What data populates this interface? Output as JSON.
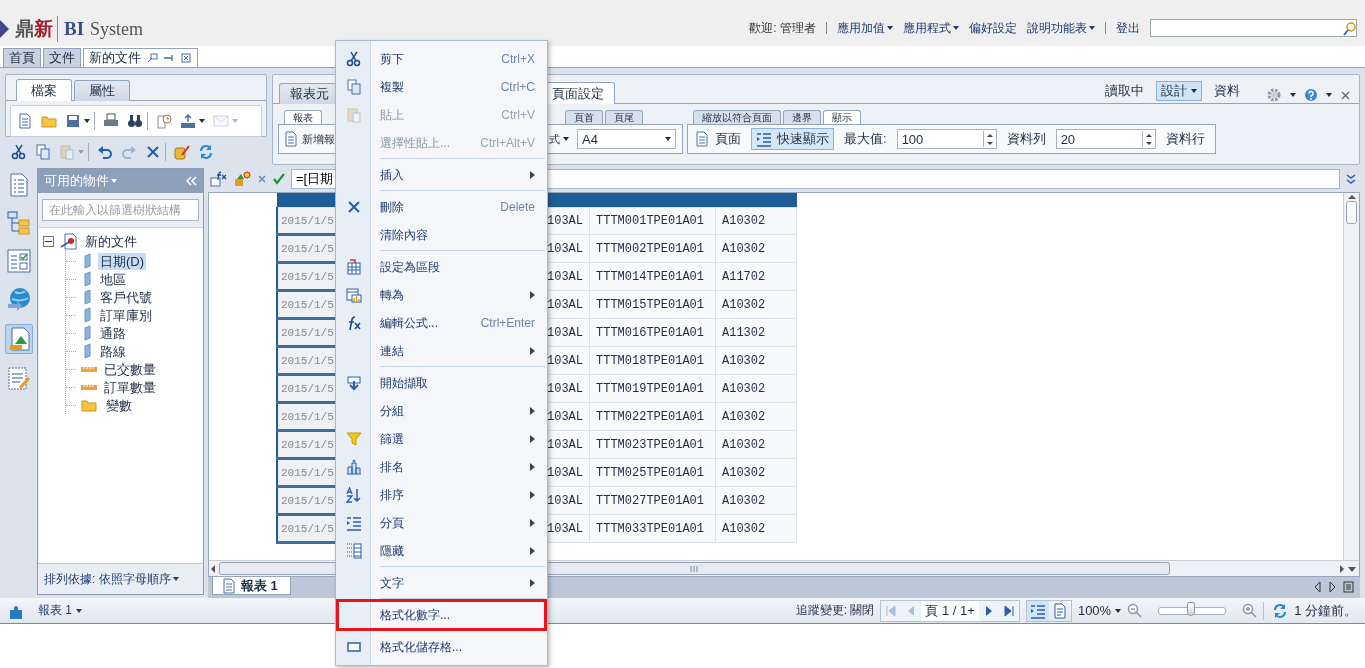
{
  "header": {
    "logo": {
      "first": "鼎",
      "second": "新",
      "product": "BI",
      "suffix": "System"
    },
    "welcome": "歡迎: 管理者",
    "menus": [
      {
        "label": "應用加值",
        "dropdown": true
      },
      {
        "label": "應用程式",
        "dropdown": true
      },
      {
        "label": "偏好設定",
        "dropdown": false
      },
      {
        "label": "說明功能表",
        "dropdown": true
      }
    ],
    "logout": "登出"
  },
  "doc_tabs": [
    {
      "label": "首頁",
      "selected": false
    },
    {
      "label": "文件",
      "selected": false
    },
    {
      "label": "新的文件",
      "selected": true
    }
  ],
  "left_ribbon": {
    "tabs": [
      {
        "label": "檔案",
        "selected": true
      },
      {
        "label": "屬性",
        "selected": false
      }
    ],
    "toolbar_rows": [
      [
        {
          "tools": [
            {
              "disabled": false,
              "dropdown": false
            },
            {
              "disabled": false,
              "dropdown": false
            },
            {
              "disabled": false,
              "dropdown": true
            }
          ]
        },
        {
          "tools": [
            {
              "disabled": false,
              "dropdown": false
            },
            {
              "disabled": false,
              "dropdown": false
            }
          ]
        },
        {
          "tools": [
            {
              "disabled": false,
              "dropdown": false
            },
            {
              "disabled": false,
              "dropdown": true
            },
            {
              "disabled": true,
              "dropdown": true
            }
          ]
        }
      ],
      [
        {
          "tools": [
            {
              "disabled": false,
              "dropdown": false
            },
            {
              "disabled": false,
              "dropdown": false
            },
            {
              "disabled": true,
              "dropdown": true
            }
          ]
        },
        {
          "tools": [
            {
              "disabled": false,
              "dropdown": false
            },
            {
              "disabled": true,
              "dropdown": false
            },
            {
              "disabled": false,
              "dropdown": false
            }
          ]
        },
        {
          "tools": [
            {
              "disabled": false,
              "dropdown": false
            },
            {
              "disabled": false,
              "dropdown": false
            }
          ]
        }
      ]
    ]
  },
  "right_ribbon": {
    "tabs": [
      {
        "label": "報表元",
        "selected": false
      },
      {
        "label": "頁面設定",
        "selected": true
      }
    ],
    "modes": [
      {
        "label": "讀取中",
        "selected": false,
        "dropdown": false
      },
      {
        "label": "設計",
        "selected": true,
        "dropdown": true
      },
      {
        "label": "資料",
        "selected": false,
        "dropdown": false
      }
    ],
    "groups": [
      {
        "subtabs": [
          {
            "label": "報表",
            "selected": true
          },
          {
            "label": "頁首",
            "selected": false
          },
          {
            "label": "頁尾",
            "selected": false
          }
        ],
        "controls": [
          {
            "kind": "button",
            "label": "新增報"
          },
          {
            "kind": "dropdown",
            "label": "式"
          },
          {
            "kind": "select",
            "value": "A4"
          }
        ]
      },
      {
        "subtabs": [
          {
            "label": "縮放以符合頁面",
            "selected": false
          },
          {
            "label": "邊界",
            "selected": false
          },
          {
            "label": "顯示",
            "selected": true
          }
        ],
        "controls": [
          {
            "kind": "button",
            "label": "頁面"
          },
          {
            "kind": "toggle",
            "label": "快速顯示",
            "pressed": true
          },
          {
            "kind": "label",
            "label": "最大值:"
          },
          {
            "kind": "spinner",
            "value": "100"
          },
          {
            "kind": "label",
            "label": "資料列"
          },
          {
            "kind": "spinner",
            "value": "20"
          },
          {
            "kind": "label",
            "label": "資料行"
          }
        ]
      }
    ]
  },
  "tool_strip": [
    {
      "selected": false
    },
    {
      "selected": false
    },
    {
      "selected": false
    },
    {
      "selected": false
    },
    {
      "selected": true
    },
    {
      "selected": false
    }
  ],
  "object_panel": {
    "title": "可用的物件",
    "filter": {
      "placeholder": "在此輸入以篩選樹狀結構"
    },
    "tree": {
      "label": "新的文件",
      "expanded": true,
      "children": [
        {
          "label": "日期(D)",
          "kind": "dimension",
          "selected": true
        },
        {
          "label": "地區",
          "kind": "dimension",
          "selected": false
        },
        {
          "label": "客戶代號",
          "kind": "dimension",
          "selected": false
        },
        {
          "label": "訂單庫別",
          "kind": "dimension",
          "selected": false
        },
        {
          "label": "通路",
          "kind": "dimension",
          "selected": false
        },
        {
          "label": "路線",
          "kind": "dimension",
          "selected": false
        },
        {
          "label": "已交數量",
          "kind": "measure",
          "selected": false
        },
        {
          "label": "訂單數量",
          "kind": "measure",
          "selected": false
        },
        {
          "label": "變數",
          "kind": "folder",
          "selected": false
        }
      ]
    },
    "sort": "排列依據: 依照字母順序"
  },
  "formula": {
    "value": "=[日期"
  },
  "table": {
    "rows": [
      [
        "2015/1/5",
        "103AL",
        "TTTM001TPE01A01",
        "A10302"
      ],
      [
        "2015/1/5",
        "103AL",
        "TTTM002TPE01A01",
        "A10302"
      ],
      [
        "2015/1/5",
        "103AL",
        "TTTM014TPE01A01",
        "A11702"
      ],
      [
        "2015/1/5",
        "103AL",
        "TTTM015TPE01A01",
        "A10302"
      ],
      [
        "2015/1/5",
        "103AL",
        "TTTM016TPE01A01",
        "A11302"
      ],
      [
        "2015/1/5",
        "103AL",
        "TTTM018TPE01A01",
        "A10302"
      ],
      [
        "2015/1/5",
        "103AL",
        "TTTM019TPE01A01",
        "A10302"
      ],
      [
        "2015/1/5",
        "103AL",
        "TTTM022TPE01A01",
        "A10302"
      ],
      [
        "2015/1/5",
        "103AL",
        "TTTM023TPE01A01",
        "A10302"
      ],
      [
        "2015/1/5",
        "103AL",
        "TTTM025TPE01A01",
        "A10302"
      ],
      [
        "2015/1/5",
        "103AL",
        "TTTM027TPE01A01",
        "A10302"
      ],
      [
        "2015/1/5",
        "103AL",
        "TTTM033TPE01A01",
        "A10302"
      ]
    ]
  },
  "report_tabs": [
    {
      "label": "報表 1",
      "selected": true
    }
  ],
  "status_bar": {
    "report": "報表 1",
    "track_changes": "追蹤變更: 關閉",
    "pager": [
      {
        "disabled": true
      },
      {
        "disabled": true
      },
      {
        "disabled": false
      },
      {
        "disabled": false
      }
    ],
    "page": "頁 1 / 1+",
    "views": [
      {
        "selected": true
      },
      {
        "selected": false
      }
    ],
    "zoom": "100%",
    "zoom_slider": {
      "level": 0.48
    },
    "refresh": "1 分鐘前。"
  },
  "context_menu": {
    "items": [
      {
        "kind": "item",
        "label": "剪下",
        "shortcut": "Ctrl+X",
        "disabled": false,
        "submenu": false,
        "outlined": false
      },
      {
        "kind": "item",
        "label": "複製",
        "shortcut": "Ctrl+C",
        "disabled": false,
        "submenu": false,
        "outlined": false
      },
      {
        "kind": "item",
        "label": "貼上",
        "shortcut": "Ctrl+V",
        "disabled": true,
        "submenu": false,
        "outlined": false
      },
      {
        "kind": "item",
        "label": "選擇性貼上...",
        "shortcut": "Ctrl+Alt+V",
        "disabled": true,
        "submenu": false,
        "outlined": false
      },
      {
        "kind": "separator"
      },
      {
        "kind": "item",
        "label": "插入",
        "disabled": false,
        "submenu": true,
        "outlined": false
      },
      {
        "kind": "separator"
      },
      {
        "kind": "item",
        "label": "刪除",
        "shortcut": "Delete",
        "disabled": false,
        "submenu": false,
        "outlined": false
      },
      {
        "kind": "item",
        "label": "清除內容",
        "disabled": false,
        "submenu": false,
        "outlined": false
      },
      {
        "kind": "separator"
      },
      {
        "kind": "item",
        "label": "設定為區段",
        "disabled": false,
        "submenu": false,
        "outlined": false
      },
      {
        "kind": "item",
        "label": "轉為",
        "disabled": false,
        "submenu": true,
        "outlined": false
      },
      {
        "kind": "item",
        "label": "編輯公式...",
        "shortcut": "Ctrl+Enter",
        "disabled": false,
        "submenu": false,
        "outlined": false
      },
      {
        "kind": "item",
        "label": "連結",
        "disabled": false,
        "submenu": true,
        "outlined": false
      },
      {
        "kind": "separator"
      },
      {
        "kind": "item",
        "label": "開始擷取",
        "disabled": false,
        "submenu": false,
        "outlined": false
      },
      {
        "kind": "item",
        "label": "分組",
        "disabled": false,
        "submenu": true,
        "outlined": false
      },
      {
        "kind": "item",
        "label": "篩選",
        "disabled": false,
        "submenu": true,
        "outlined": false
      },
      {
        "kind": "item",
        "label": "排名",
        "disabled": false,
        "submenu": true,
        "outlined": false
      },
      {
        "kind": "item",
        "label": "排序",
        "disabled": false,
        "submenu": true,
        "outlined": false
      },
      {
        "kind": "item",
        "label": "分頁",
        "disabled": false,
        "submenu": true,
        "outlined": false
      },
      {
        "kind": "item",
        "label": "隱藏",
        "disabled": false,
        "submenu": true,
        "outlined": false
      },
      {
        "kind": "separator"
      },
      {
        "kind": "item",
        "label": "文字",
        "disabled": false,
        "submenu": true,
        "outlined": false
      },
      {
        "kind": "separator"
      },
      {
        "kind": "item",
        "label": "格式化數字...",
        "disabled": false,
        "submenu": false,
        "outlined": true
      },
      {
        "kind": "separator"
      },
      {
        "kind": "item",
        "label": "格式化儲存格...",
        "disabled": false,
        "submenu": false,
        "outlined": false
      }
    ]
  }
}
